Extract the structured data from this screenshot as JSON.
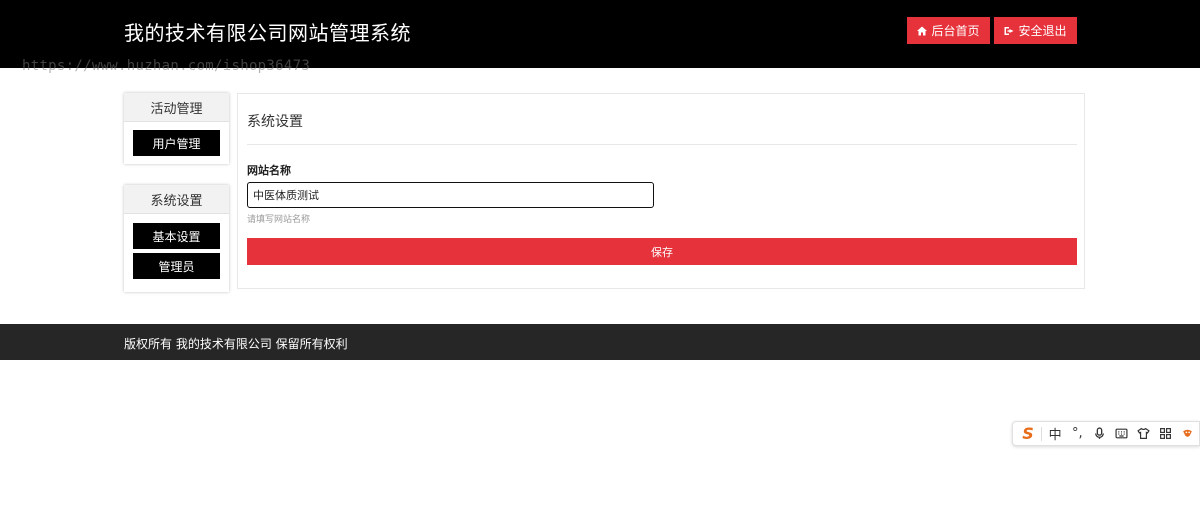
{
  "header": {
    "title": "我的技术有限公司网站管理系统",
    "home_button": "后台首页",
    "logout_button": "安全退出"
  },
  "watermark": "https://www.huzhan.com/ishop36473",
  "sidebar": {
    "groups": [
      {
        "title": "活动管理",
        "items": [
          {
            "label": "用户管理"
          }
        ]
      },
      {
        "title": "系统设置",
        "items": [
          {
            "label": "基本设置"
          },
          {
            "label": "管理员"
          }
        ]
      }
    ]
  },
  "main": {
    "title": "系统设置",
    "field": {
      "label": "网站名称",
      "value": "中医体质测试",
      "help": "请填写网站名称"
    },
    "save_button": "保存"
  },
  "footer": {
    "text": "版权所有 我的技术有限公司 保留所有权利"
  },
  "ime_toolbar": {
    "logo": "S",
    "mode": "中",
    "punct": "°,"
  },
  "colors": {
    "accent": "#e5323b",
    "header_bg": "#000000",
    "footer_bg": "#262626"
  }
}
